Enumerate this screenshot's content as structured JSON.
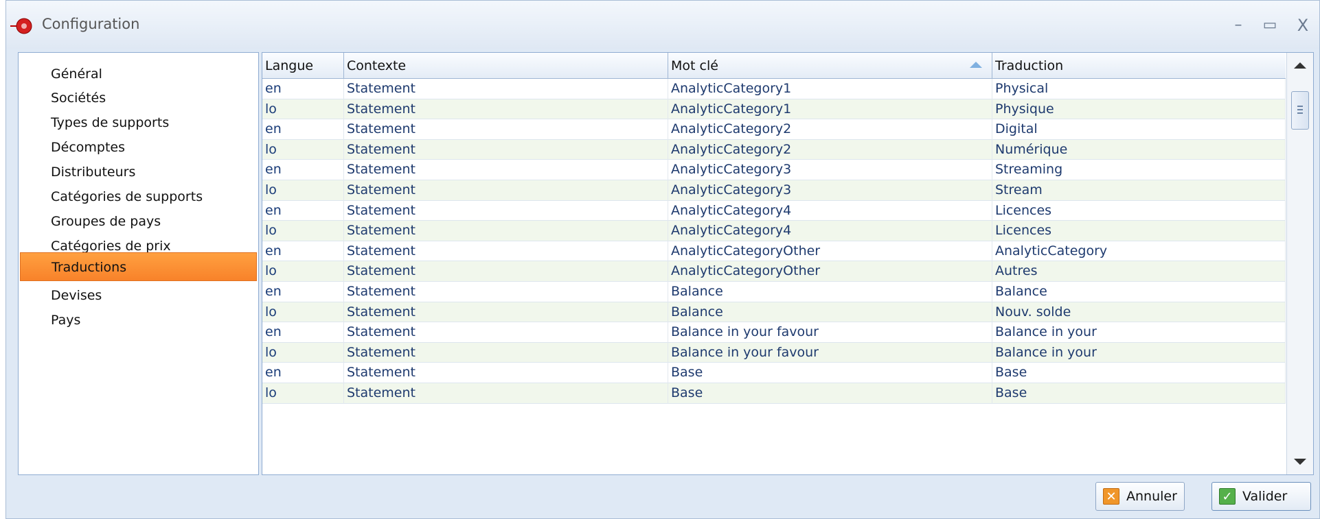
{
  "window": {
    "title": "Configuration",
    "controls": {
      "minimize": "–",
      "maximize": "▭",
      "close": "X"
    }
  },
  "sidebar": {
    "items": [
      {
        "label": "Général"
      },
      {
        "label": "Sociétés"
      },
      {
        "label": "Types de supports"
      },
      {
        "label": "Décomptes"
      },
      {
        "label": "Distributeurs"
      },
      {
        "label": "Catégories de supports"
      },
      {
        "label": "Groupes de pays"
      },
      {
        "label": "Catégories de prix"
      },
      {
        "label": "Traductions",
        "selected": true
      },
      {
        "label": "Devises"
      },
      {
        "label": "Pays"
      }
    ],
    "selected_color": "#f8822a"
  },
  "grid": {
    "columns": [
      "Langue",
      "Contexte",
      "Mot clé",
      "Traduction"
    ],
    "sorted_column": "Mot clé",
    "sort_direction": "ascending",
    "rows": [
      [
        "en",
        "Statement",
        "AnalyticCategory1",
        "Physical"
      ],
      [
        "lo",
        "Statement",
        "AnalyticCategory1",
        "Physique"
      ],
      [
        "en",
        "Statement",
        "AnalyticCategory2",
        "Digital"
      ],
      [
        "lo",
        "Statement",
        "AnalyticCategory2",
        "Numérique"
      ],
      [
        "en",
        "Statement",
        "AnalyticCategory3",
        "Streaming"
      ],
      [
        "lo",
        "Statement",
        "AnalyticCategory3",
        "Stream"
      ],
      [
        "en",
        "Statement",
        "AnalyticCategory4",
        "Licences"
      ],
      [
        "lo",
        "Statement",
        "AnalyticCategory4",
        "Licences"
      ],
      [
        "en",
        "Statement",
        "AnalyticCategoryOther",
        "AnalyticCategory"
      ],
      [
        "lo",
        "Statement",
        "AnalyticCategoryOther",
        "Autres"
      ],
      [
        "en",
        "Statement",
        "Balance",
        "Balance"
      ],
      [
        "lo",
        "Statement",
        "Balance",
        "Nouv. solde"
      ],
      [
        "en",
        "Statement",
        "Balance in your favour",
        "Balance in your"
      ],
      [
        "lo",
        "Statement",
        "Balance in your favour",
        "Balance in your"
      ],
      [
        "en",
        "Statement",
        "Base",
        "Base"
      ],
      [
        "lo",
        "Statement",
        "Base",
        "Base"
      ]
    ],
    "alt_row_color": "#f1f7ec"
  },
  "buttons": {
    "cancel": {
      "label": "Annuler",
      "icon": "cancel-x-icon",
      "glyph": "✕"
    },
    "ok": {
      "label": "Valider",
      "icon": "check-icon",
      "glyph": "✓"
    }
  }
}
